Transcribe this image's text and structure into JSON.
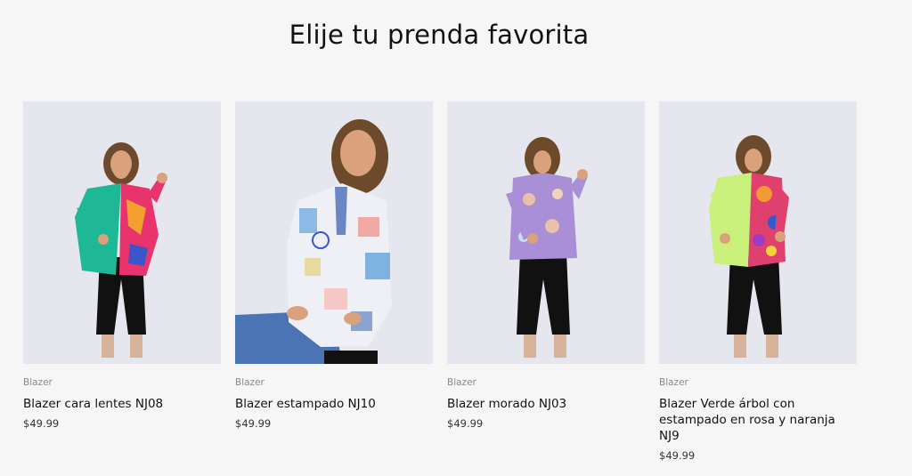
{
  "section": {
    "heading": "Elije tu prenda favorita"
  },
  "products": [
    {
      "vendor": "Blazer",
      "title": "Blazer cara lentes NJ08",
      "price": "$49.99",
      "blazer_color": "#1fb896",
      "accent_color": "#e8336c"
    },
    {
      "vendor": "Blazer",
      "title": "Blazer estampado NJ10",
      "price": "$49.99",
      "blazer_color": "#eef0f6",
      "accent_color": "#7fb2e0"
    },
    {
      "vendor": "Blazer",
      "title": "Blazer morado NJ03",
      "price": "$49.99",
      "blazer_color": "#a98fd6",
      "accent_color": "#e7c2a8"
    },
    {
      "vendor": "Blazer",
      "title": "Blazer Verde árbol con estampado en rosa y naranja NJ9",
      "price": "$49.99",
      "blazer_color": "#c8f07a",
      "accent_color": "#e0406e"
    }
  ]
}
